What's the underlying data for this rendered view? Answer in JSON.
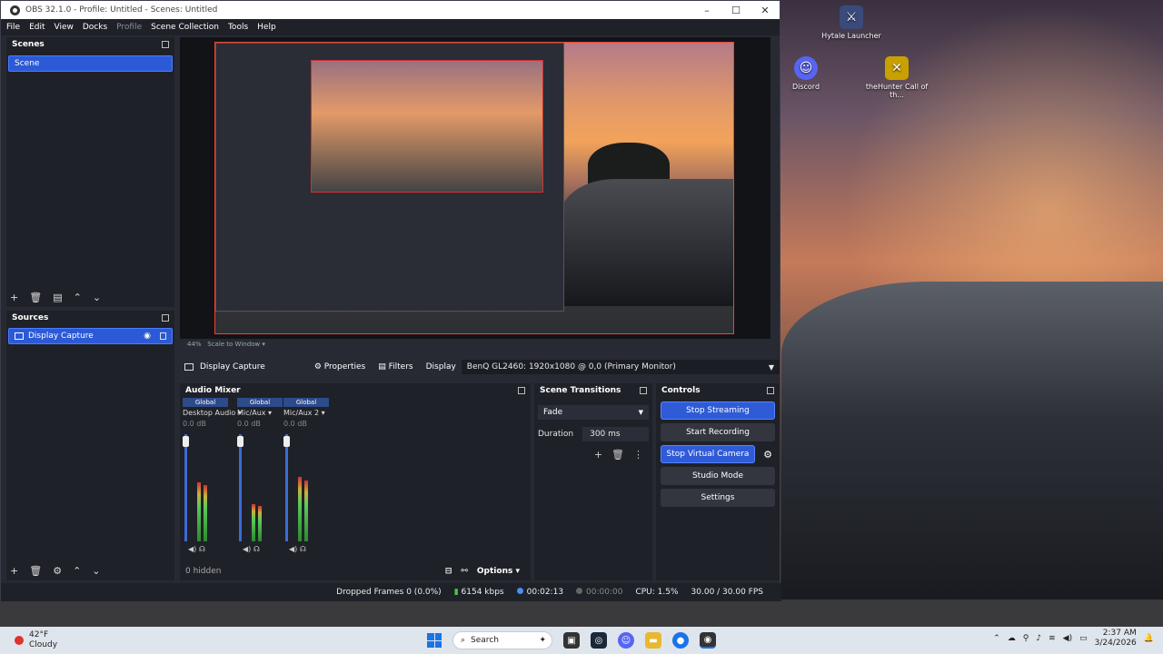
{
  "window": {
    "title": "OBS 32.1.0 - Profile: Untitled - Scenes: Untitled"
  },
  "menu": [
    "File",
    "Edit",
    "View",
    "Docks",
    "Profile",
    "Scene Collection",
    "Tools",
    "Help"
  ],
  "scenes": {
    "title": "Scenes",
    "items": [
      "Scene"
    ]
  },
  "sources": {
    "title": "Sources",
    "items": [
      "Display Capture"
    ]
  },
  "preview": {
    "zoom": "44%",
    "mode": "Scale to Window"
  },
  "source_toolbar": {
    "source": "Display Capture",
    "properties": "Properties",
    "filters": "Filters",
    "display_label": "Display",
    "display_value": "BenQ GL2460: 1920x1080 @ 0,0 (Primary Monitor)"
  },
  "audio_mixer": {
    "title": "Audio Mixer",
    "channels": [
      {
        "badge": "Global",
        "name": "Desktop Audio",
        "db": "0.0 dB",
        "level": 0.55
      },
      {
        "badge": "Global",
        "name": "Mic/Aux",
        "db": "0.0 dB",
        "level": 0.35
      },
      {
        "badge": "Global",
        "name": "Mic/Aux 2",
        "db": "0.0 dB",
        "level": 0.6
      }
    ],
    "hidden": "0 hidden",
    "options": "Options"
  },
  "transitions": {
    "title": "Scene Transitions",
    "selected": "Fade",
    "duration_label": "Duration",
    "duration": "300 ms"
  },
  "controls": {
    "title": "Controls",
    "stop_streaming": "Stop Streaming",
    "start_recording": "Start Recording",
    "stop_virtual_camera": "Stop Virtual Camera",
    "studio_mode": "Studio Mode",
    "settings": "Settings"
  },
  "status": {
    "dropped": "Dropped Frames 0 (0.0%)",
    "kbps": "6154 kbps",
    "stream_time": "00:02:13",
    "rec_time": "00:00:00",
    "cpu": "CPU: 1.5%",
    "fps": "30.00 / 30.00 FPS"
  },
  "desktop": {
    "icons": [
      {
        "label": "Hytale Launcher"
      },
      {
        "label": "Discord"
      },
      {
        "label": "theHunter Call of th..."
      }
    ]
  },
  "taskbar": {
    "temp": "42°F",
    "weather": "Cloudy",
    "search": "Search",
    "time": "2:37 AM",
    "date": "3/24/2026"
  }
}
